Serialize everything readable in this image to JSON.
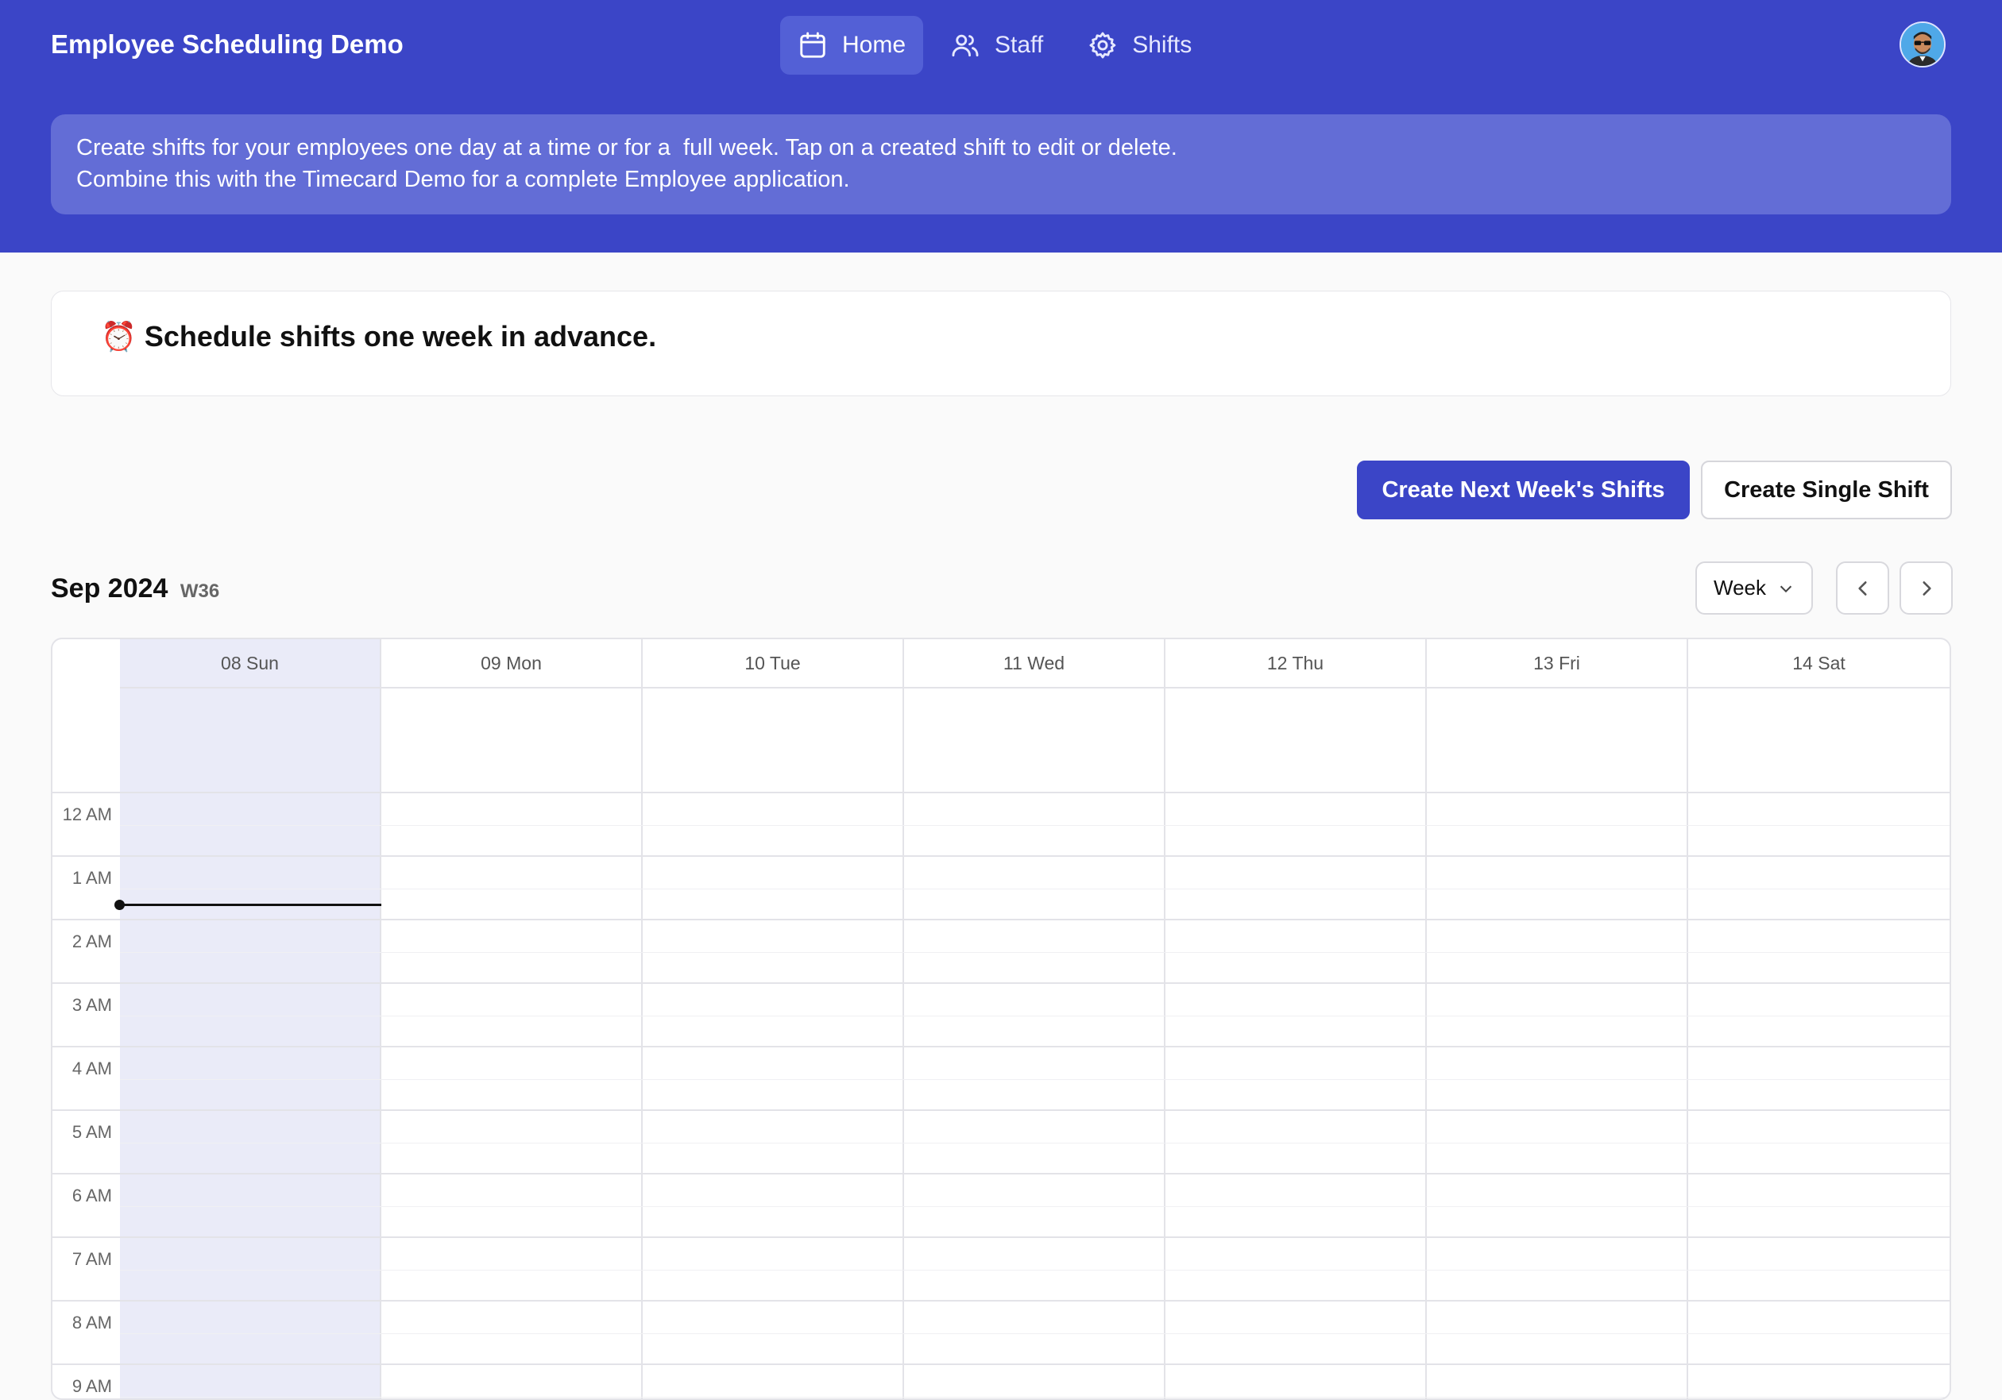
{
  "header": {
    "app_title": "Employee Scheduling Demo",
    "nav": [
      {
        "label": "Home",
        "icon": "calendar-icon",
        "active": true
      },
      {
        "label": "Staff",
        "icon": "users-icon",
        "active": false
      },
      {
        "label": "Shifts",
        "icon": "gear-icon",
        "active": false
      }
    ],
    "brand_color": "#3b45c7"
  },
  "banner": {
    "line1": "Create shifts for your employees one day at a time or for a  full week. Tap on a created shift to edit or delete.",
    "line2": "Combine this with the Timecard Demo for a complete Employee application."
  },
  "card": {
    "emoji": "⏰",
    "text": "Schedule shifts one week in advance."
  },
  "actions": {
    "create_week": "Create Next Week's Shifts",
    "create_single": "Create Single Shift"
  },
  "calendar": {
    "month": "Sep 2024",
    "week": "W36",
    "view": "Week",
    "days": [
      "08 Sun",
      "09 Mon",
      "10 Tue",
      "11 Wed",
      "12 Thu",
      "13 Fri",
      "14 Sat"
    ],
    "today_index": 0,
    "hours": [
      "12 AM",
      "1 AM",
      "2 AM",
      "3 AM",
      "4 AM",
      "5 AM",
      "6 AM",
      "7 AM",
      "8 AM",
      "9 AM"
    ]
  }
}
